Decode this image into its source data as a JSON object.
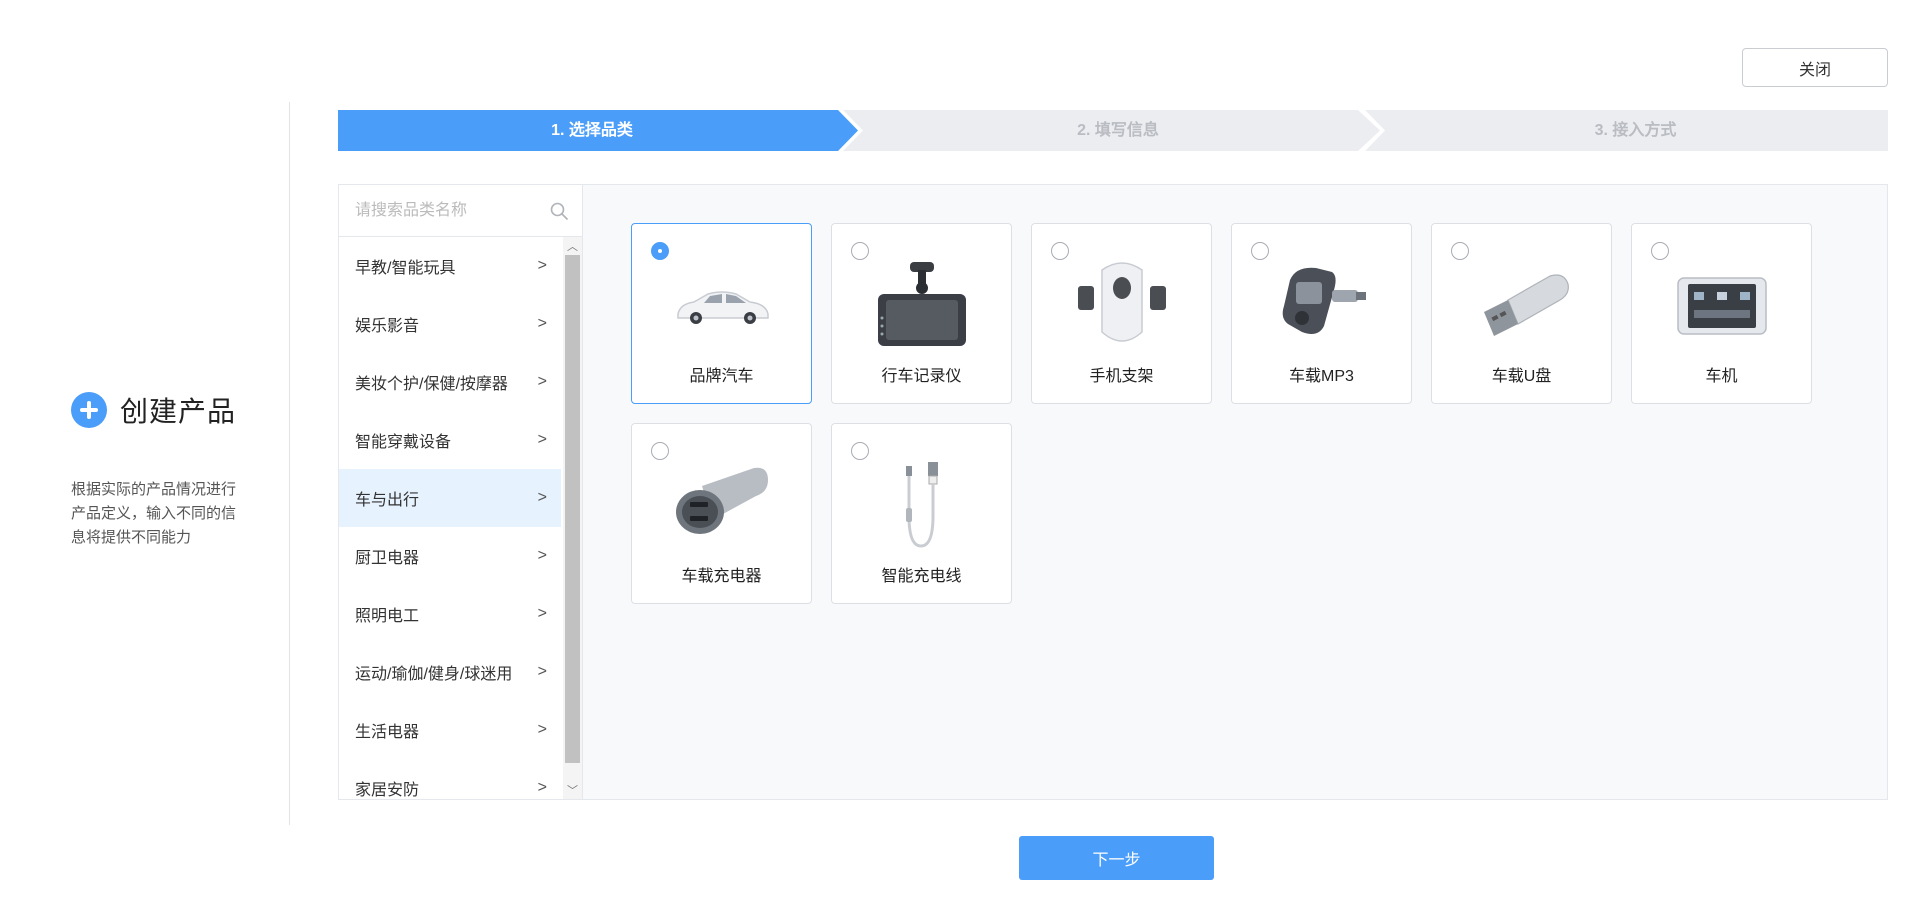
{
  "intro": {
    "title": "创建产品",
    "description": "根据实际的产品情况进行产品定义，输入不同的信息将提供不同能力"
  },
  "header": {
    "close_label": "关闭"
  },
  "steps": [
    {
      "label": "1. 选择品类",
      "active": true
    },
    {
      "label": "2. 填写信息",
      "active": false
    },
    {
      "label": "3. 接入方式",
      "active": false
    }
  ],
  "search": {
    "placeholder": "请搜索品类名称",
    "value": ""
  },
  "categories": [
    {
      "label": "早教/智能玩具",
      "active": false
    },
    {
      "label": "娱乐影音",
      "active": false
    },
    {
      "label": "美妆个护/保健/按摩器",
      "active": false
    },
    {
      "label": "智能穿戴设备",
      "active": false
    },
    {
      "label": "车与出行",
      "active": true
    },
    {
      "label": "厨卫电器",
      "active": false
    },
    {
      "label": "照明电工",
      "active": false
    },
    {
      "label": "运动/瑜伽/健身/球迷用",
      "active": false
    },
    {
      "label": "生活电器",
      "active": false
    },
    {
      "label": "家居安防",
      "active": false
    }
  ],
  "products": [
    {
      "label": "品牌汽车",
      "icon": "car-icon",
      "selected": true
    },
    {
      "label": "行车记录仪",
      "icon": "dashcam-icon",
      "selected": false
    },
    {
      "label": "手机支架",
      "icon": "phone-holder-icon",
      "selected": false
    },
    {
      "label": "车载MP3",
      "icon": "car-mp3-icon",
      "selected": false
    },
    {
      "label": "车载U盘",
      "icon": "usb-drive-icon",
      "selected": false
    },
    {
      "label": "车机",
      "icon": "car-head-unit-icon",
      "selected": false
    },
    {
      "label": "车载充电器",
      "icon": "car-charger-icon",
      "selected": false
    },
    {
      "label": "智能充电线",
      "icon": "charging-cable-icon",
      "selected": false
    }
  ],
  "footer": {
    "next_label": "下一步"
  },
  "colors": {
    "accent": "#4a9df8",
    "active_category_bg": "#e6f2fd",
    "step_inactive_bg": "#ecedf1"
  }
}
